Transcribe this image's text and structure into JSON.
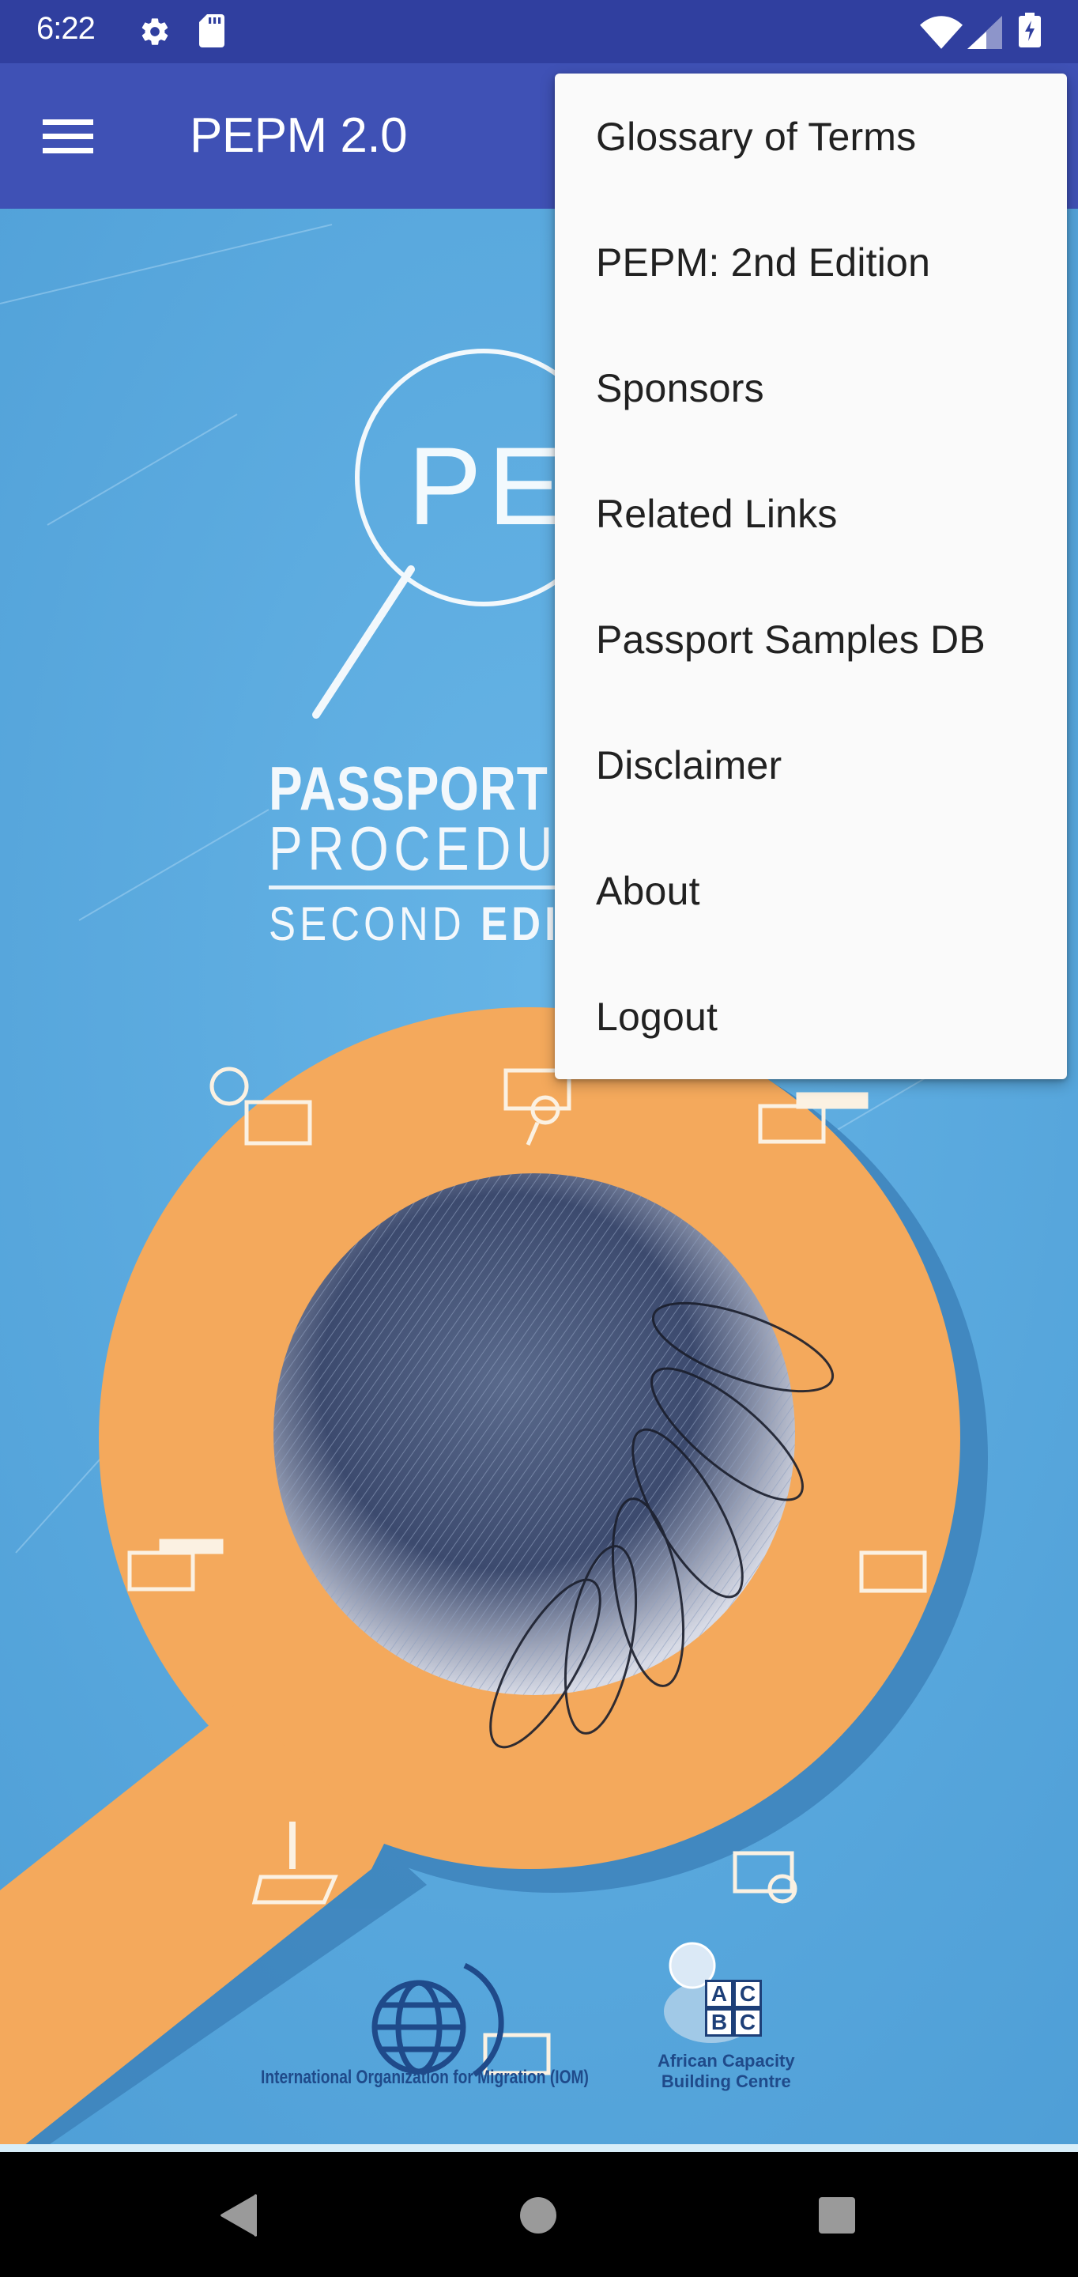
{
  "status_bar": {
    "time": "6:22",
    "left_icons": [
      "gear-icon",
      "sd-card-icon"
    ],
    "right_icons": [
      "wifi-icon",
      "cell-signal-icon",
      "battery-charging-icon"
    ]
  },
  "app_bar": {
    "menu_icon": "hamburger-menu-icon",
    "title": "PEPM 2.0",
    "color": "#3f51b5",
    "status_color": "#303f9f"
  },
  "cover": {
    "logo_text": "PEPM",
    "title_line1_bold": "PASSPORT EX",
    "title_line2": "PROCEDURE",
    "edition_light": "SECOND ",
    "edition_bold": "EDITIO",
    "iom_caption": "International Organization for Migration (IOM)",
    "acbc_letters": [
      "A",
      "C",
      "B",
      "C"
    ],
    "acbc_caption_line1": "African Capacity",
    "acbc_caption_line2": "Building Centre",
    "background_color": "#5aa9df",
    "accent_color": "#f4a95c"
  },
  "overflow_menu": {
    "items": [
      {
        "label": "Glossary of Terms"
      },
      {
        "label": "PEPM: 2nd Edition"
      },
      {
        "label": "Sponsors"
      },
      {
        "label": "Related Links"
      },
      {
        "label": "Passport Samples DB"
      },
      {
        "label": "Disclaimer"
      },
      {
        "label": "About"
      },
      {
        "label": "Logout"
      }
    ]
  },
  "nav_bar": {
    "buttons": [
      "back-icon",
      "home-icon",
      "recents-icon"
    ]
  }
}
